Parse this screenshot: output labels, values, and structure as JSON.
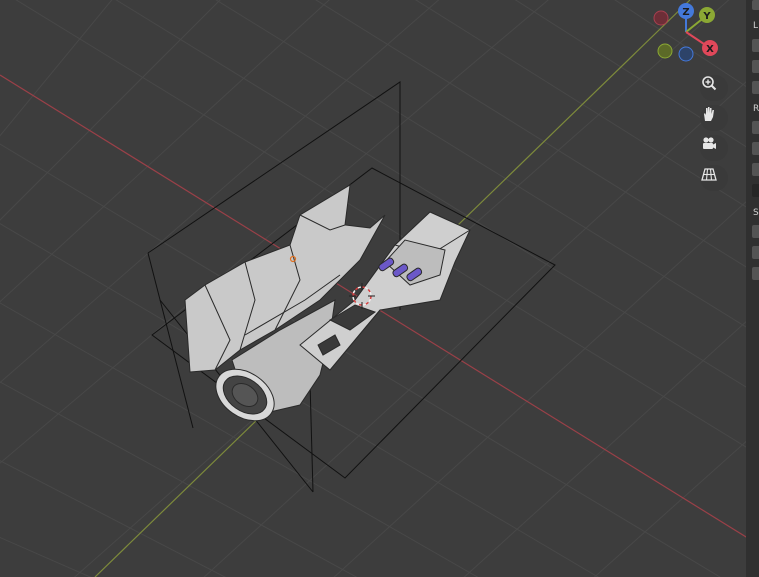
{
  "gizmo": {
    "axis_z": "Z",
    "axis_y": "Y",
    "axis_x": "X",
    "colors": {
      "x": "#e0485a",
      "y": "#8ba834",
      "z": "#4479db"
    }
  },
  "nav_buttons": [
    {
      "icon": "zoom-icon"
    },
    {
      "icon": "pan-hand-icon"
    },
    {
      "icon": "camera-icon"
    },
    {
      "icon": "perspective-grid-icon"
    }
  ],
  "side_panel": {
    "section_letters": [
      "L",
      "R",
      "S"
    ]
  },
  "viewport": {
    "background": "#3d3d3d",
    "x_axis_color": "#9a4048",
    "y_axis_color": "#7d8a3b"
  }
}
